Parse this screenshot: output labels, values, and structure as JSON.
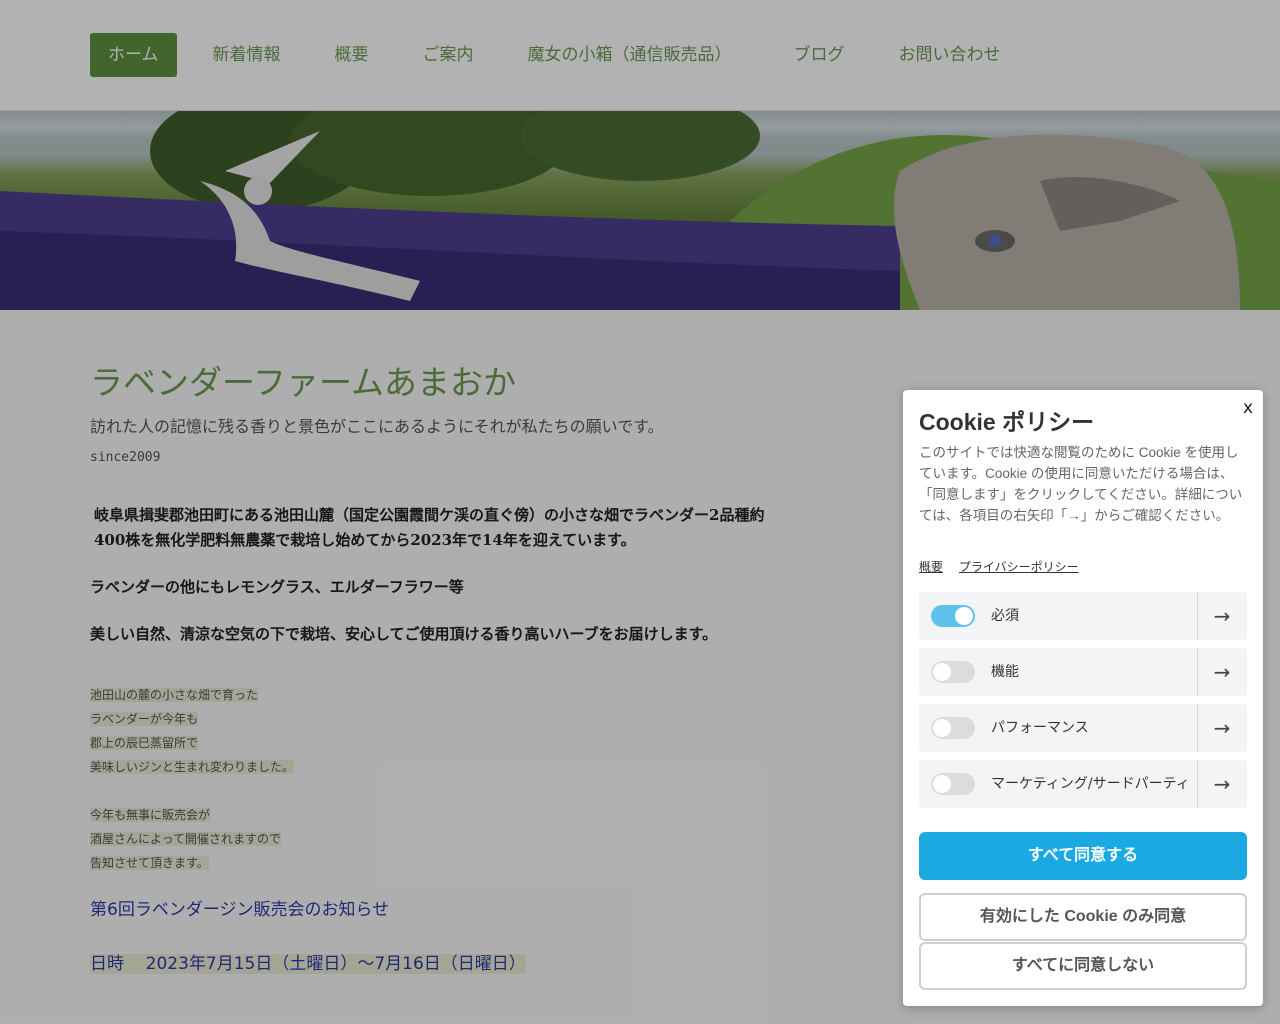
{
  "nav": {
    "items": [
      "ホーム",
      "新着情報",
      "概要",
      "ご案内",
      "魔女の小箱（通信販売品）",
      "ブログ",
      "お問い合わせ"
    ],
    "active_index": 0
  },
  "main": {
    "site_title": "ラベンダーファームあまおか",
    "tagline": "訪れた人の記憶に残る香りと景色がここにあるようにそれが私たちの願いです。",
    "since": "since2009",
    "para1_line1": "岐阜県揖斐郡池田町にある池田山麓（国定公園霞間ケ渓の直ぐ傍）の小さな畑でラベンダー2品種約",
    "para1_line2": "400株を無化学肥料無農薬で栽培し始めてから2023年で14年を迎えています。",
    "para2": "ラベンダーの他にもレモングラス、エルダーフラワー等",
    "para3": "美しい自然、清涼な空気の下で栽培、安心してご使用頂ける香り高いハーブをお届けします。",
    "small_block1": [
      "池田山の麓の小さな畑で育った",
      "ラベンダーが今年も",
      "郡上の辰巳蒸留所で",
      "美味しいジンと生まれ変わりました。"
    ],
    "small_block2": [
      "今年も無事に販売会が",
      "酒屋さんによって開催されますので",
      "告知させて頂きます。"
    ],
    "notice_link": "第6回ラベンダージン販売会のお知らせ",
    "date_label": "日時",
    "date_value": "2023年7月15日（土曜日）～7月16日（日曜日）"
  },
  "cookie": {
    "close": "x",
    "title": "Cookie ポリシー",
    "description": "このサイトでは快適な閲覧のために Cookie を使用しています。Cookie の使用に同意いただける場合は、「同意します」をクリックしてください。詳細については、各項目の右矢印「→」からご確認ください。",
    "link_overview": "概要",
    "link_privacy": "プライバシーポリシー",
    "categories": [
      {
        "label": "必須",
        "enabled": true
      },
      {
        "label": "機能",
        "enabled": false
      },
      {
        "label": "パフォーマンス",
        "enabled": false
      },
      {
        "label": "マーケティング/サードパーティ",
        "enabled": false
      }
    ],
    "arrow": "→",
    "accept_all": "すべて同意する",
    "accept_selected": "有効にした Cookie のみ同意",
    "reject_all": "すべてに同意しない"
  },
  "colors": {
    "nav_green": "#6b9a53",
    "nav_active_bg": "#5f9142",
    "link_blue": "#2a3caa",
    "accept_blue": "#1ba9e1",
    "toggle_on": "#5ec2ea"
  }
}
